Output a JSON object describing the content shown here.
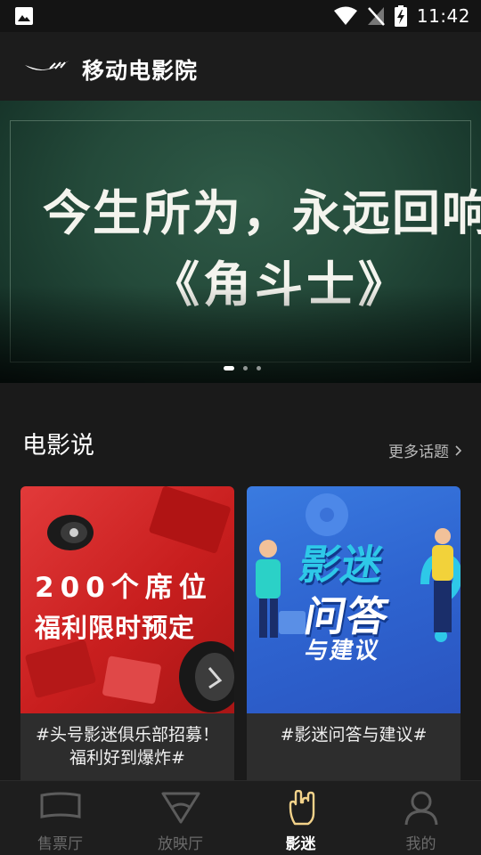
{
  "status_bar": {
    "time": "11:42"
  },
  "header": {
    "title": "移动电影院"
  },
  "banner": {
    "line1": "今生所为，永远回响。",
    "line2": "《角斗士》",
    "slide_count": 3,
    "active_slide": 1
  },
  "section": {
    "title": "电影说",
    "more_label": "更多话题"
  },
  "cards": [
    {
      "image_text_1": "200个席位",
      "image_text_2": "福利限时预定",
      "caption": "#头号影迷俱乐部招募！福利好到爆炸#"
    },
    {
      "image_text_1": "影迷",
      "image_text_2": "问答",
      "image_text_3": "与建议",
      "caption": "#影迷问答与建议#"
    }
  ],
  "bottom_nav": [
    {
      "label": "售票厅",
      "icon": "ticket-screen-icon",
      "active": false
    },
    {
      "label": "放映厅",
      "icon": "projection-triangle-icon",
      "active": false
    },
    {
      "label": "影迷",
      "icon": "rock-hand-icon",
      "active": true
    },
    {
      "label": "我的",
      "icon": "user-icon",
      "active": false
    }
  ],
  "colors": {
    "background": "#1a1a1a",
    "nav_inactive": "#6b6b6b",
    "nav_active": "#ffffff",
    "card_red": "#d42a2a",
    "card_blue": "#2f65d2"
  }
}
